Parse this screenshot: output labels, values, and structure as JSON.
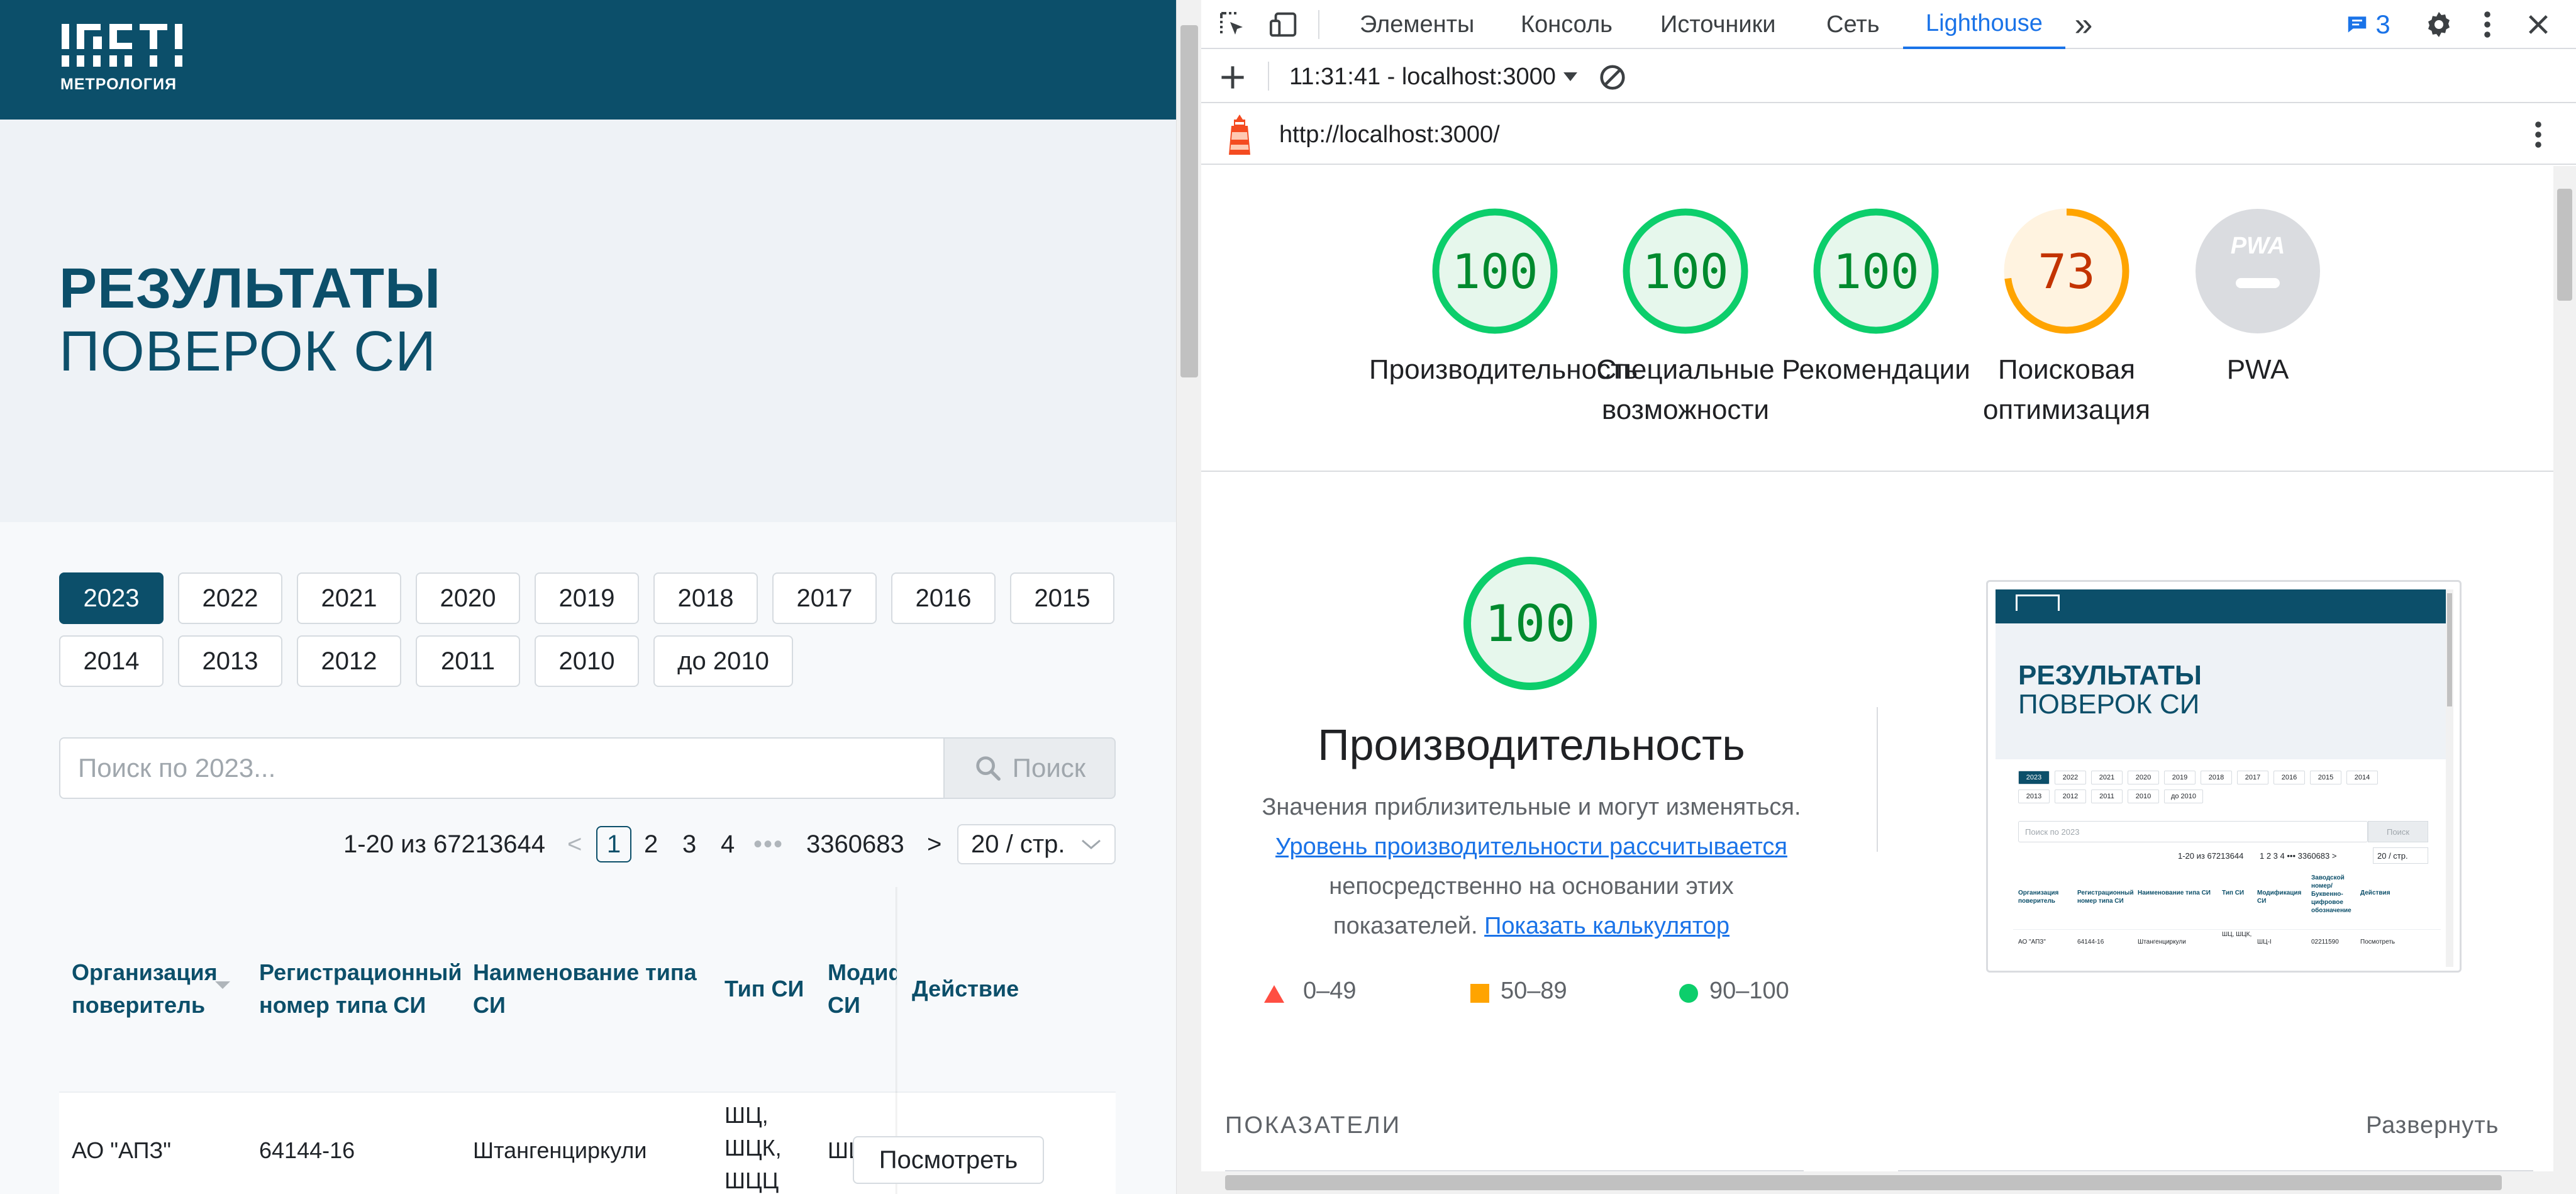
{
  "site": {
    "logo_main": "ГРСТІ",
    "logo_sub": "МЕТРОЛОГИЯ",
    "hero_title_line1": "РЕЗУЛЬТАТЫ",
    "hero_title_line2": "ПОВЕРОК СИ"
  },
  "years": {
    "row1": [
      "2023",
      "2022",
      "2021",
      "2020",
      "2019",
      "2018",
      "2017",
      "2016",
      "2015"
    ],
    "row2": [
      "2014",
      "2013",
      "2012",
      "2011",
      "2010",
      "до 2010"
    ],
    "active": "2023"
  },
  "search": {
    "placeholder": "Поиск по 2023...",
    "button_label": "Поиск"
  },
  "pagination": {
    "range_text": "1-20 из 67213644",
    "prev": "<",
    "pages": [
      "1",
      "2",
      "3",
      "4"
    ],
    "ellipsis": "•••",
    "last_page": "3360683",
    "next": ">",
    "page_size": "20 / стр."
  },
  "table": {
    "headers": {
      "org": [
        "Организация",
        "поверитель"
      ],
      "reg": [
        "Регистрационный",
        "номер типа СИ"
      ],
      "name": [
        "Наименование типа",
        "СИ"
      ],
      "type": [
        "Тип СИ"
      ],
      "mod": [
        "Модиф",
        "СИ"
      ],
      "action": [
        "Действие"
      ]
    },
    "row1": {
      "org": "АО \"АПЗ\"",
      "reg": "64144-16",
      "name": "Штангенциркули",
      "type": [
        "ШЦ,",
        "ШЦК,",
        "ШЦЦ"
      ],
      "mod": "ШЦ-I",
      "action": "Посмотреть"
    }
  },
  "devtools": {
    "tabs": [
      "Элементы",
      "Консоль",
      "Источники",
      "Сеть",
      "Lighthouse"
    ],
    "active_tab": "Lighthouse",
    "more_tabs": "»",
    "messages_count": "3",
    "session": "11:31:41 - localhost:3000",
    "url": "http://localhost:3000/",
    "accent_color": "#1a73e8"
  },
  "lighthouse": {
    "gauges": [
      {
        "score": "100",
        "value": 100,
        "label_lines": [
          "Производительность"
        ],
        "color": "#0cce6b",
        "text_color": "#008a2e",
        "bg": "#e6f7ec"
      },
      {
        "score": "100",
        "value": 100,
        "label_lines": [
          "Специальные",
          "возможности"
        ],
        "color": "#0cce6b",
        "text_color": "#008a2e",
        "bg": "#e6f7ec"
      },
      {
        "score": "100",
        "value": 100,
        "label_lines": [
          "Рекомендации"
        ],
        "color": "#0cce6b",
        "text_color": "#008a2e",
        "bg": "#e6f7ec"
      },
      {
        "score": "73",
        "value": 73,
        "label_lines": [
          "Поисковая",
          "оптимизация"
        ],
        "color": "#ffa400",
        "text_color": "#c33300",
        "bg": "#fff3e0"
      },
      {
        "score": "PWA",
        "value": 0,
        "label_lines": [
          "PWA"
        ],
        "color": "#dadce0",
        "text_color": "#ffffff",
        "bg": "#dadce0"
      }
    ],
    "perf": {
      "score": "100",
      "title": "Производительность",
      "desc_line1": "Значения приблизительные и могут изменяться.",
      "link1": "Уровень производительности рассчитывается",
      "desc_line3": "непосредственно на основании этих",
      "desc_line4_prefix": "показателей.",
      "link2": "Показать калькулятор"
    },
    "legend": [
      {
        "range": "0–49",
        "shape": "triangle",
        "color": "#ff4e42"
      },
      {
        "range": "50–89",
        "shape": "square",
        "color": "#ffa400"
      },
      {
        "range": "90–100",
        "shape": "circle",
        "color": "#0cce6b"
      }
    ],
    "metrics_header": "ПОКАЗАТЕЛИ",
    "expand_label": "Развернуть",
    "thumbnail": {
      "title1": "РЕЗУЛЬТАТЫ",
      "title2": "ПОВЕРОК СИ",
      "years_row1": [
        "2023",
        "2022",
        "2021",
        "2020",
        "2019",
        "2018",
        "2017",
        "2016",
        "2015",
        "2014"
      ],
      "years_row2": [
        "2013",
        "2012",
        "2011",
        "2010",
        "до 2010"
      ],
      "search_placeholder": "Поиск по 2023",
      "search_btn": "Поиск",
      "pager": "1-20 из 67213644",
      "pager_pages": "1 2 3 4 ••• 3360683 >",
      "page_size": "20 / стр.",
      "headers": [
        "Организация поверитель",
        "Регистрационный номер типа СИ",
        "Наименование типа СИ",
        "Тип СИ",
        "Модификация СИ",
        "Заводской номер/ Буквенно-цифровое обозначение",
        "Действия"
      ],
      "row": [
        "АО \"АПЗ\"",
        "64144-16",
        "Штангенциркули",
        "ШЦ, ШЦК,",
        "ШЦ-I",
        "02211590",
        "Посмотреть"
      ]
    }
  }
}
